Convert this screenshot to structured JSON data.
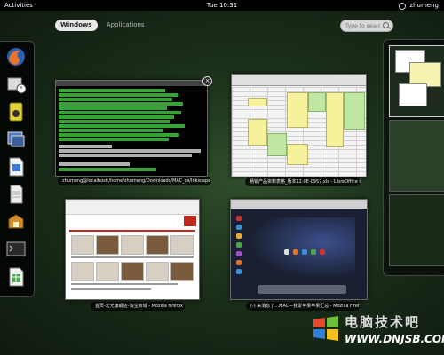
{
  "topbar": {
    "activities": "Activities",
    "clock": "Tue 10:31",
    "user": "zhumeng"
  },
  "tabs": [
    {
      "label": "Windows",
      "active": true
    },
    {
      "label": "Applications",
      "active": false
    }
  ],
  "search": {
    "placeholder": "Type to search..."
  },
  "dash": [
    {
      "name": "firefox-icon",
      "color": "#e8742b"
    },
    {
      "name": "evolution-mail-icon",
      "color": "#d9d9d9"
    },
    {
      "name": "rhythmbox-icon",
      "color": "#e4d23c"
    },
    {
      "name": "shotwell-icon",
      "color": "#4a7bc4"
    },
    {
      "name": "libreoffice-writer-icon",
      "color": "#3d7ad9"
    },
    {
      "name": "document-icon",
      "color": "#eeeeee"
    },
    {
      "name": "software-install-icon",
      "color": "#d7902f"
    },
    {
      "name": "terminal-icon",
      "color": "#3b3b3b"
    },
    {
      "name": "libreoffice-calc-icon",
      "color": "#4aa84a"
    }
  ],
  "windows": [
    {
      "caption": "zhumeng@localhost:/home/zhumeng/Downloads/MAC_os/Inkscape-0.48.0"
    },
    {
      "caption": "畅销产品资料表格_版本12.0E-0957.xls - LibreOffice Calc"
    },
    {
      "caption": "首页-宏光旗舰店-淘宝商城 - Mozilla Firefox"
    },
    {
      "caption": "(-) 来消息了...MAC—我爱苹果苹果汇总 - Mozilla Firefox"
    }
  ],
  "watermark": {
    "cn": "电脑技术吧",
    "url": "WWW.DNJSB.COM"
  },
  "colors": {
    "accent": "#e8e8e8",
    "background": "#1f331d"
  }
}
